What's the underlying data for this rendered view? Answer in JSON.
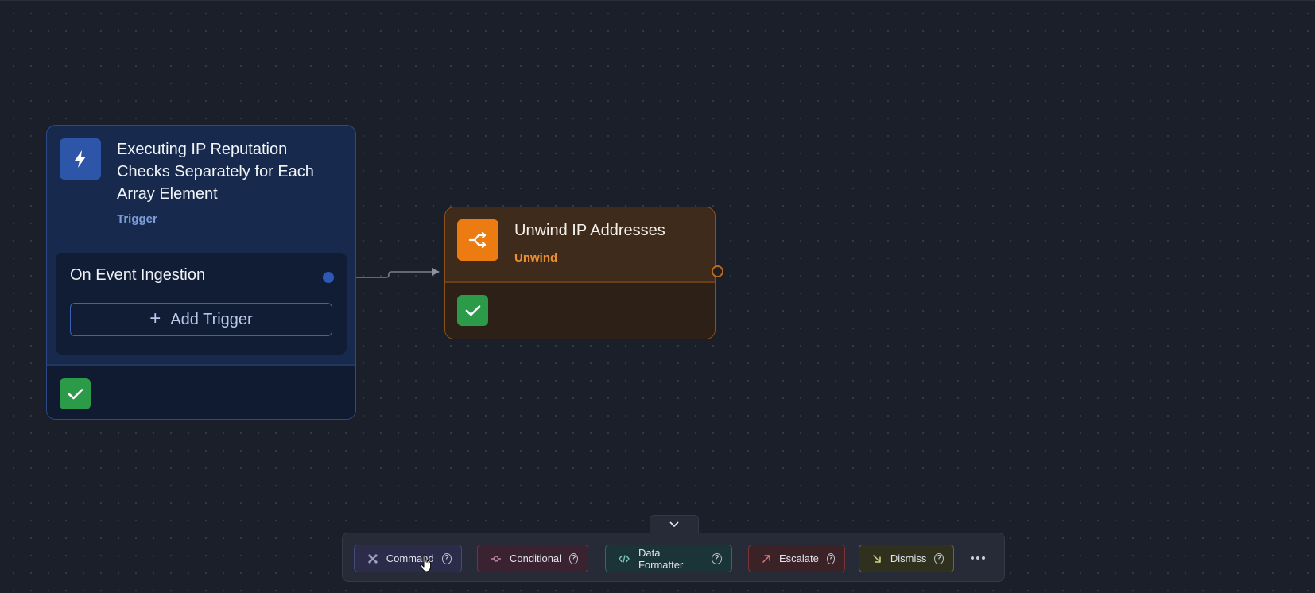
{
  "colors": {
    "canvas": "#1b1f29",
    "trigger_accent": "#2d55a8",
    "unwind_accent": "#ec7c12",
    "success": "#2b9b49"
  },
  "trigger_node": {
    "icon": "lightning-bolt-icon",
    "title": "Executing IP Reputation Checks Separately for Each Array Element",
    "type_label": "Trigger",
    "event_label": "On Event Ingestion",
    "add_trigger_label": "Add Trigger",
    "status_icon": "check-icon"
  },
  "unwind_node": {
    "icon": "split-arrows-icon",
    "title": "Unwind IP Addresses",
    "type_label": "Unwind",
    "status_icon": "check-icon"
  },
  "toolbar": {
    "collapse_icon": "chevron-down-icon",
    "items": [
      {
        "label": "Command",
        "icon": "command-icon"
      },
      {
        "label": "Conditional",
        "icon": "conditional-icon"
      },
      {
        "label": "Data Formatter",
        "icon": "code-icon"
      },
      {
        "label": "Escalate",
        "icon": "arrow-up-right-icon"
      },
      {
        "label": "Dismiss",
        "icon": "arrow-down-right-icon"
      }
    ],
    "help_glyph": "?",
    "more_icon": "more-horizontal-icon"
  }
}
